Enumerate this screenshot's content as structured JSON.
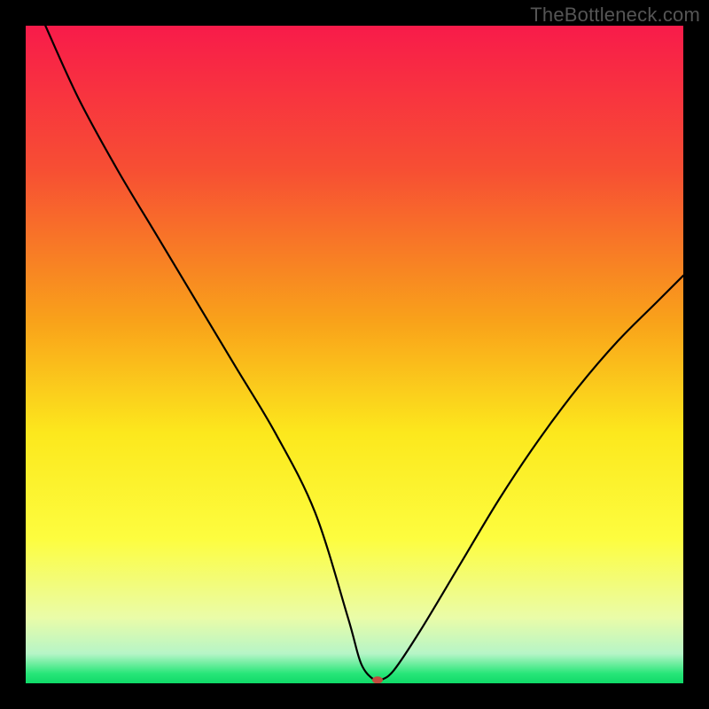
{
  "watermark": "TheBottleneck.com",
  "chart_data": {
    "type": "line",
    "title": "",
    "xlabel": "",
    "ylabel": "",
    "xlim": [
      0,
      100
    ],
    "ylim": [
      0,
      100
    ],
    "grid": false,
    "legend": false,
    "background_gradient": {
      "stops": [
        {
          "offset": 0.0,
          "color": "#f81b4a"
        },
        {
          "offset": 0.22,
          "color": "#f74f33"
        },
        {
          "offset": 0.45,
          "color": "#f9a21a"
        },
        {
          "offset": 0.62,
          "color": "#fce81d"
        },
        {
          "offset": 0.78,
          "color": "#fdfd3f"
        },
        {
          "offset": 0.9,
          "color": "#eafca8"
        },
        {
          "offset": 0.955,
          "color": "#b6f5c7"
        },
        {
          "offset": 0.985,
          "color": "#28e679"
        },
        {
          "offset": 1.0,
          "color": "#0fd968"
        }
      ]
    },
    "series": [
      {
        "name": "bottleneck-curve",
        "x": [
          3,
          8,
          14,
          20,
          26,
          32,
          38,
          44,
          49,
          51,
          53,
          54,
          56,
          60,
          66,
          72,
          78,
          84,
          90,
          96,
          100
        ],
        "y": [
          100,
          89,
          78,
          68,
          58,
          48,
          38,
          26,
          10,
          3,
          0.5,
          0.5,
          2,
          8,
          18,
          28,
          37,
          45,
          52,
          58,
          62
        ]
      }
    ],
    "marker": {
      "name": "optimum-marker",
      "x": 53.5,
      "y": 0.5,
      "color": "#c44a3e",
      "rx": 6,
      "ry": 4
    }
  }
}
